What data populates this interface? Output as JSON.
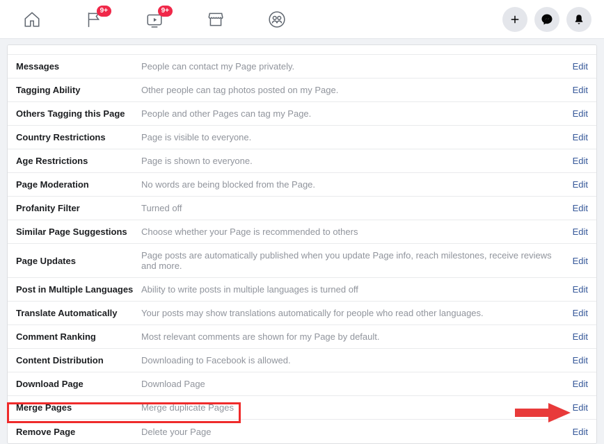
{
  "topbar": {
    "badge_pages": "9+",
    "badge_watch": "9+"
  },
  "edit_label": "Edit",
  "rows": [
    {
      "label": "Messages",
      "desc": "People can contact my Page privately."
    },
    {
      "label": "Tagging Ability",
      "desc": "Other people can tag photos posted on my Page."
    },
    {
      "label": "Others Tagging this Page",
      "desc": "People and other Pages can tag my Page."
    },
    {
      "label": "Country Restrictions",
      "desc": "Page is visible to everyone."
    },
    {
      "label": "Age Restrictions",
      "desc": "Page is shown to everyone."
    },
    {
      "label": "Page Moderation",
      "desc": "No words are being blocked from the Page."
    },
    {
      "label": "Profanity Filter",
      "desc": "Turned off"
    },
    {
      "label": "Similar Page Suggestions",
      "desc": "Choose whether your Page is recommended to others"
    },
    {
      "label": "Page Updates",
      "desc": "Page posts are automatically published when you update Page info, reach milestones, receive reviews and more."
    },
    {
      "label": "Post in Multiple Languages",
      "desc": "Ability to write posts in multiple languages is turned off"
    },
    {
      "label": "Translate Automatically",
      "desc": "Your posts may show translations automatically for people who read other languages."
    },
    {
      "label": "Comment Ranking",
      "desc": "Most relevant comments are shown for my Page by default."
    },
    {
      "label": "Content Distribution",
      "desc": "Downloading to Facebook is allowed."
    },
    {
      "label": "Download Page",
      "desc": "Download Page"
    },
    {
      "label": "Merge Pages",
      "desc": "Merge duplicate Pages"
    },
    {
      "label": "Remove Page",
      "desc": "Delete your Page"
    }
  ]
}
